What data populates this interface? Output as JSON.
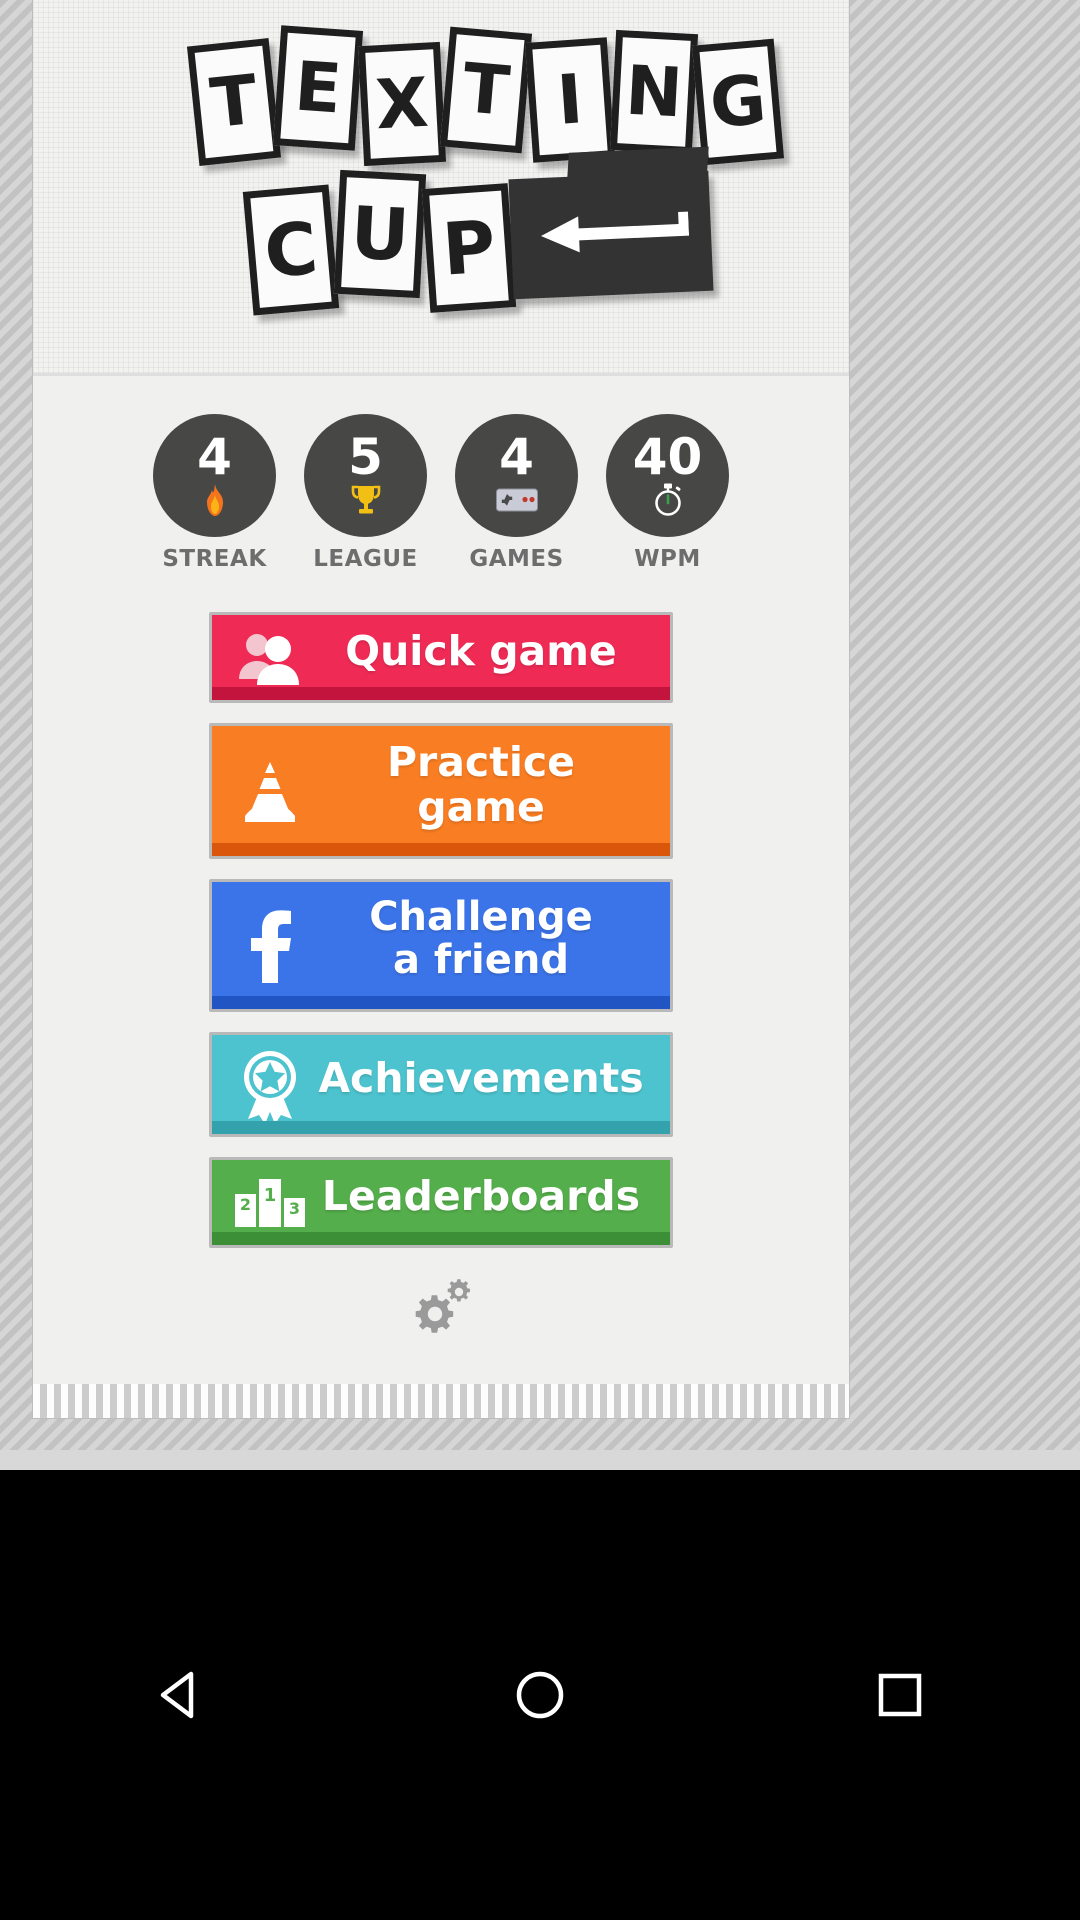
{
  "app": {
    "title_line1": "TEXTING",
    "title_line2": "CUP",
    "logo_letters_row1": [
      "T",
      "E",
      "X",
      "T",
      "I",
      "N",
      "G"
    ],
    "logo_letters_row2": [
      "C",
      "U",
      "P"
    ],
    "enter_key_icon": "enter-arrow-icon"
  },
  "stats": [
    {
      "value": "4",
      "label": "STREAK",
      "icon": "flame-icon",
      "icon_color": "#f07020"
    },
    {
      "value": "5",
      "label": "LEAGUE",
      "icon": "trophy-icon",
      "icon_color": "#f2c014"
    },
    {
      "value": "4",
      "label": "GAMES",
      "icon": "gamepad-icon",
      "icon_color": "#c9ccd6"
    },
    {
      "value": "40",
      "label": "WPM",
      "icon": "stopwatch-icon",
      "icon_color": "#ffffff"
    }
  ],
  "menu": [
    {
      "label": "Quick game",
      "icon": "people-icon",
      "color": "#ef2b55",
      "shadow": "#c2143c"
    },
    {
      "label": "Practice game",
      "icon": "traffic-cone-icon",
      "color": "#f97d22",
      "shadow": "#d9560b"
    },
    {
      "label": "Challenge\na friend",
      "icon": "facebook-icon",
      "color": "#3b74e8",
      "shadow": "#2255c4"
    },
    {
      "label": "Achievements",
      "icon": "award-ribbon-icon",
      "color": "#4cc3ce",
      "shadow": "#33a2ad"
    },
    {
      "label": "Leaderboards",
      "icon": "podium-icon",
      "color": "#54ae4b",
      "shadow": "#3c8f36"
    }
  ],
  "settings": {
    "icon": "gear-icon",
    "color": "#9a9a9a"
  },
  "navbar": {
    "back_label": "back-triangle-icon",
    "home_label": "home-circle-icon",
    "recents_label": "recents-square-icon"
  },
  "colors": {
    "circle_bg": "#474746",
    "app_bg": "#f0f0ef",
    "label_gray": "#6d6d6d"
  }
}
